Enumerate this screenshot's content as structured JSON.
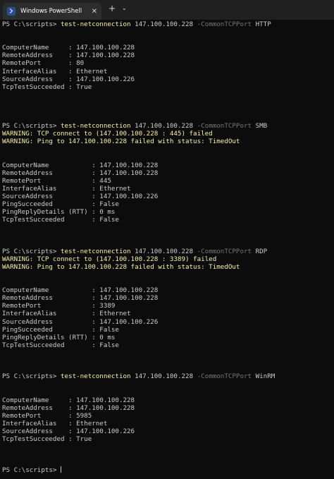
{
  "tab": {
    "title": "Windows PowerShell",
    "close_glyph": "✕",
    "icon": "powershell-icon"
  },
  "toolbar": {
    "new_tab_glyph": "+",
    "dropdown_glyph": "⌄"
  },
  "colors": {
    "background": "#0c0c0c",
    "text": "#cccccc",
    "command": "#f9f1a5",
    "parameter": "#767676",
    "warning": "#f9f1a5"
  },
  "terminal": {
    "blocks": [
      {
        "prompt": "PS C:\\scripts> ",
        "command": "test-netconnection",
        "address": " 147.100.100.228 ",
        "parameter": "-CommonTCPPort",
        "port_name": " HTTP",
        "warnings": [],
        "rows": [
          "ComputerName     : 147.100.100.228",
          "RemoteAddress    : 147.100.100.228",
          "RemotePort       : 80",
          "InterfaceAlias   : Ethernet",
          "SourceAddress    : 147.100.100.226",
          "TcpTestSucceeded : True"
        ]
      },
      {
        "prompt": "PS C:\\scripts> ",
        "command": "test-netconnection",
        "address": " 147.100.100.228 ",
        "parameter": "-CommonTCPPort",
        "port_name": " SMB",
        "warnings": [
          "WARNING: TCP connect to (147.100.100.228 : 445) failed",
          "WARNING: Ping to 147.100.100.228 failed with status: TimedOut"
        ],
        "rows": [
          "ComputerName           : 147.100.100.228",
          "RemoteAddress          : 147.100.100.228",
          "RemotePort             : 445",
          "InterfaceAlias         : Ethernet",
          "SourceAddress          : 147.100.100.226",
          "PingSucceeded          : False",
          "PingReplyDetails (RTT) : 0 ms",
          "TcpTestSucceeded       : False"
        ]
      },
      {
        "prompt": "PS C:\\scripts> ",
        "command": "test-netconnection",
        "address": " 147.100.100.228 ",
        "parameter": "-CommonTCPPort",
        "port_name": " RDP",
        "warnings": [
          "WARNING: TCP connect to (147.100.100.228 : 3389) failed",
          "WARNING: Ping to 147.100.100.228 failed with status: TimedOut"
        ],
        "rows": [
          "ComputerName           : 147.100.100.228",
          "RemoteAddress          : 147.100.100.228",
          "RemotePort             : 3389",
          "InterfaceAlias         : Ethernet",
          "SourceAddress          : 147.100.100.226",
          "PingSucceeded          : False",
          "PingReplyDetails (RTT) : 0 ms",
          "TcpTestSucceeded       : False"
        ]
      },
      {
        "prompt": "PS C:\\scripts> ",
        "command": "test-netconnection",
        "address": " 147.100.100.228 ",
        "parameter": "-CommonTCPPort",
        "port_name": " WinRM",
        "warnings": [],
        "rows": [
          "ComputerName     : 147.100.100.228",
          "RemoteAddress    : 147.100.100.228",
          "RemotePort       : 5985",
          "InterfaceAlias   : Ethernet",
          "SourceAddress    : 147.100.100.226",
          "TcpTestSucceeded : True"
        ]
      }
    ],
    "final_prompt": "PS C:\\scripts> "
  }
}
